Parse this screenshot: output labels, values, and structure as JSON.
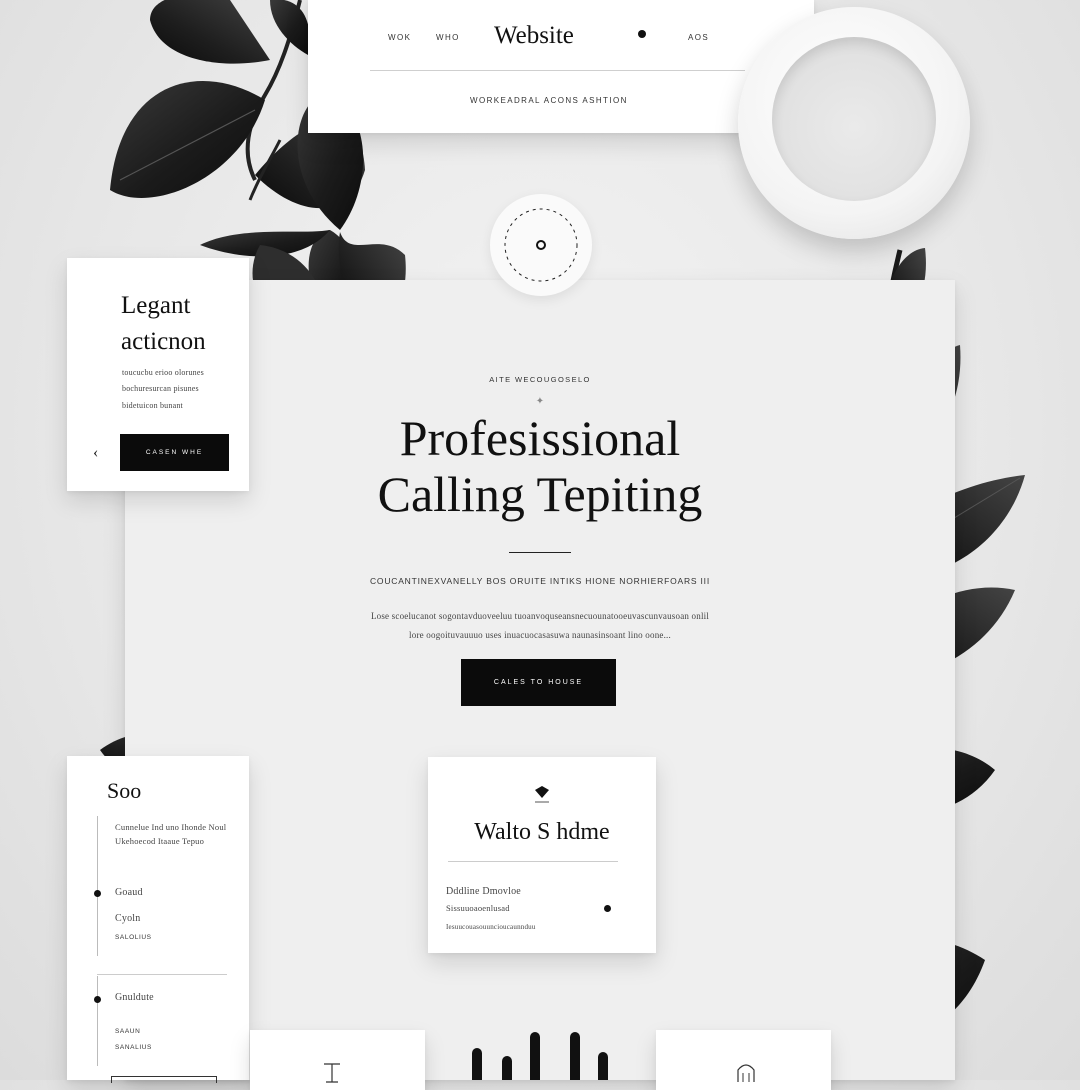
{
  "header": {
    "nav_left": [
      "WOK",
      "WHO"
    ],
    "title": "Website",
    "nav_right": [
      "AOS"
    ],
    "tagline": "WORKEADRAL ACONS ASHTION"
  },
  "left_card": {
    "title_line1": "Legant",
    "title_line2": "acticnon",
    "lines": [
      "toucucbu erioo olorunes",
      "bochuresurcan pisunes",
      "bidetuicon bunant"
    ],
    "button_label": "CASEN WHE",
    "back_arrow": "‹"
  },
  "hero": {
    "eyebrow": "AITE WECOUGOSELO",
    "sparkle": "✦",
    "title_line1": "Profesissional",
    "title_line2": "Calling Tepiting",
    "subheading": "COUCANTINEXVANELLY BOS ORUITE INTIKS HIONE NORHIERFOARS III",
    "body_line1": "Lose scoelucanot sogontavduoveeluu tuoanvoquseansnecuounatooeuvascunvausoan onlil",
    "body_line2": "lore oogoituvauuuo uses inuacuocasasuwa naunasinsoant lino oone...",
    "button_label": "CALES TO HOUSE"
  },
  "bottom_left_card": {
    "title": "Soo",
    "intro_lines": [
      "Cunnelue Ind uno Ihonde Noul",
      "Ukehoecod Itaaue Tepuo"
    ],
    "items": [
      {
        "label": "Goaud",
        "sub": "Cyoln",
        "meta": "SALOLIUS"
      },
      {
        "label": "Gnuldute",
        "sub": "Saaun",
        "meta": "SANALIUS"
      }
    ]
  },
  "center_card": {
    "title": "Walto S hdme",
    "heading": "Dddline Dmovloe",
    "line1": "Sissuuoaoenlusad",
    "line2": "Iesuucouasouuncioucaunnduu"
  },
  "colors": {
    "accent": "#0b0b0b",
    "leaf_dark": "#1c1c1c",
    "background": "#e9e9e9",
    "card": "#ffffff"
  }
}
